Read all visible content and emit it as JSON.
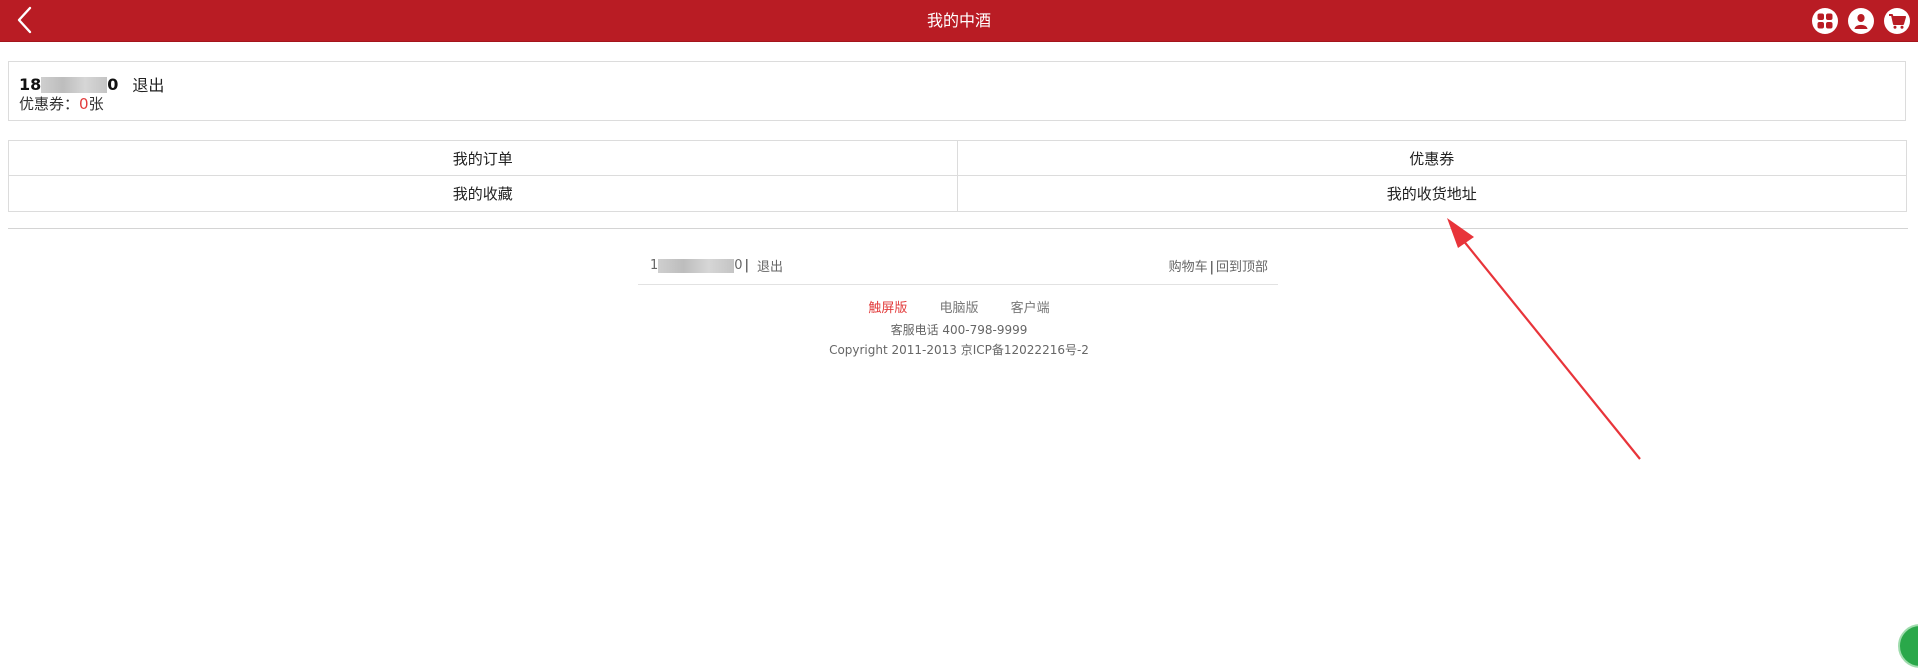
{
  "header": {
    "title": "我的中酒",
    "back_icon": "chevron-left-icon",
    "right_icons": [
      "apps-grid-icon",
      "user-icon",
      "cart-icon"
    ]
  },
  "user_panel": {
    "phone_prefix": "18",
    "phone_suffix": "0",
    "logout_label": "退出",
    "coupon_prefix": "优惠券：",
    "coupon_count": "0",
    "coupon_unit": "张"
  },
  "menu": {
    "items": [
      {
        "label": "我的订单"
      },
      {
        "label": "优惠券"
      },
      {
        "label": "我的收藏"
      },
      {
        "label": "我的收货地址"
      }
    ]
  },
  "footer": {
    "phone_prefix": "1",
    "phone_suffix": "0",
    "separator": "|",
    "logout_label": "退出",
    "cart_label": "购物车",
    "back_to_top_label": "回到顶部",
    "versions": [
      "触屏版",
      "电脑版",
      "客户端"
    ],
    "active_version": "触屏版",
    "service_phone": "客服电话 400-798-9999",
    "copyright": "Copyright 2011-2013 京ICP备12022216号-2"
  },
  "colors": {
    "brand_red": "#b91c24",
    "accent_red": "#e23c3c",
    "arrow_red": "#e8343a"
  }
}
